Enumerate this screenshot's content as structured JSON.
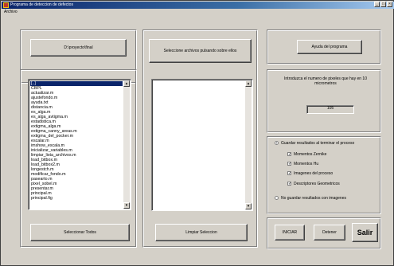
{
  "window": {
    "title": "Programa de deteccion de defectos",
    "menu": "Archivo"
  },
  "left": {
    "dir_button": "D:\\proyecto\\final",
    "files": [
      "[..]",
      "CBPL",
      "actualizar.m",
      "ajustefondo.m",
      "ayuda.txt",
      "distancia.m",
      "es_alga.m",
      "es_alga_avtigma.m",
      "estadistica.m",
      "extigma_alga.m",
      "extigma_canny_areas.m",
      "extigma_del_pocker.m",
      "escalar.m",
      "imshow_escala.m",
      "inicializar_variables.m",
      "limpiar_lista_archivos.m",
      "load_bitbox.m",
      "load_bitbox2.m",
      "longestch.m",
      "modificar_fondo.m",
      "pasearto.m",
      "pixel_sobel.m",
      "presentar.m",
      "principal.m",
      "principal.fig"
    ],
    "select_all_button": "Seleccionar Todos"
  },
  "middle": {
    "header_button": "Seleccione archivos pulsando sobre ellos",
    "clear_button": "Limpiar Seleccion"
  },
  "right": {
    "help_button": "Ayuda del programa",
    "pixels_label": "Introduzca el numero de pixeles que hay en 10 micrometros",
    "pixels_value": "105",
    "save_results_label": "Guardar resultados al terminar el proceso",
    "options": [
      {
        "label": "Momentos Zernike",
        "checked": true
      },
      {
        "label": "Momentos Hu",
        "checked": true
      },
      {
        "label": "Imagenes del proceso",
        "checked": true
      },
      {
        "label": "Descriptores Geometricos",
        "checked": true
      }
    ],
    "no_save_label": "No guardar resultados con imagenes",
    "start_button": "INICIAR",
    "stop_button": "Detener",
    "exit_button": "Salir"
  }
}
